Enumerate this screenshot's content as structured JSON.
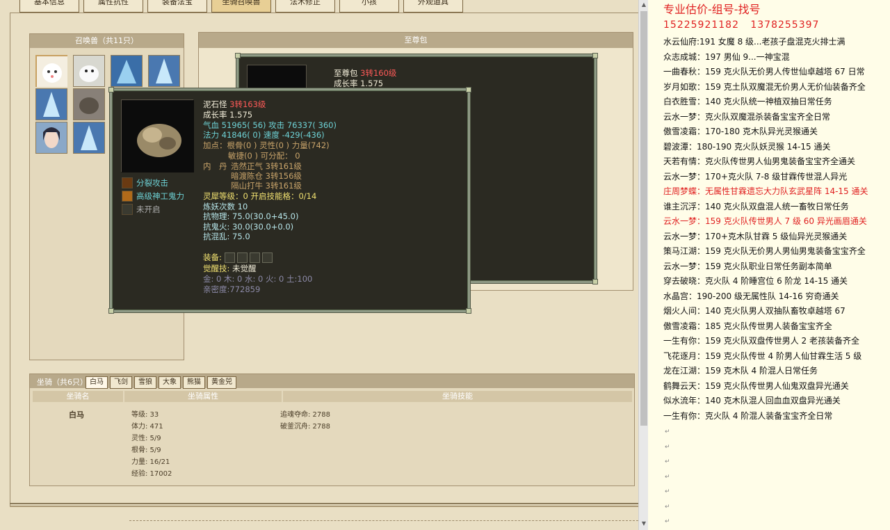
{
  "tabs": [
    "基本信息",
    "属性抗性",
    "装备法宝",
    "坐骑召唤兽",
    "法术修正",
    "小孩",
    "外观道具"
  ],
  "active_tab": 3,
  "summon_panel": {
    "title": "召唤兽（共11只）"
  },
  "my_panel": {
    "title": "至尊包"
  },
  "back_tip": {
    "name": "至尊包",
    "level": "3转160级",
    "growth": "成长率 1.575"
  },
  "tip": {
    "name": "泥石怪",
    "level": "3转163级",
    "growth": "成长率 1.575",
    "hp_label": "气血",
    "hp_val": "51965( 56)",
    "atk_label": "攻击",
    "atk_val": "76337( 360)",
    "mp_label": "法力",
    "mp_val": "41846( 0)",
    "spd_label": "速度",
    "spd_val": "-429(-436)",
    "points1": "加点：根骨(0 ) 灵性(0 ) 力量(742)",
    "points2": "敏捷(0 ) 可分配： 0",
    "inner_label": "内　丹",
    "inner1": "浩然正气 3转161级",
    "inner2": "暗渡陈仓 3转156级",
    "inner3": "隔山打牛 3转161级",
    "spirit_a": "灵犀等级：",
    "spirit_b": "0",
    "spirit_c": "开启技能格：",
    "spirit_d": "0/14",
    "refine_label": "炼妖次数",
    "refine_val": "10",
    "res1_label": "抗物理:",
    "res1_val": "75.0(30.0+45.0)",
    "res2_label": "抗鬼火:",
    "res2_val": "30.0(30.0+0.0)",
    "res3_label": "抗混乱:",
    "res3_val": "75.0",
    "equip_label": "装备:",
    "awake_label": "觉醒技:",
    "awake_val": "未觉醒",
    "elements": "金: 0 木: 0 水: 0 火: 0 土:100",
    "intimacy": "亲密度:772859",
    "skills": [
      "分裂攻击",
      "高级神工鬼力",
      "未开启"
    ]
  },
  "mount": {
    "title": "坐骑（共6只）",
    "tabs": [
      "白马",
      "飞剑",
      "雪狼",
      "大象",
      "熊猫",
      "黄金兕"
    ],
    "headers": [
      "坐骑名",
      "坐骑属性",
      "坐骑技能"
    ],
    "name": "白马",
    "attrs": [
      "等级: 33",
      "体力: 471",
      "灵性: 5/9",
      "根骨: 5/9",
      "力量: 16/21",
      "经验: 17002"
    ],
    "skills": [
      "追魂夺命: 2788",
      "破釜沉舟: 2788"
    ]
  },
  "doc": {
    "title": "专业估价-组号-找号",
    "phone1": "15225921182",
    "phone2": "1378255397",
    "lines": [
      {
        "t": "水云仙府:191 女魔 8 级...老孩子盘混克火排士满",
        "red": false
      },
      {
        "t": "众志成城：197 男仙 9...一神宝混",
        "red": false
      },
      {
        "t": "一曲春秋：159 克火队无价男人传世仙卓越塔 67 日常",
        "red": false
      },
      {
        "t": "岁月如歌：159 克土队双魔混无价男人无价仙装备齐全",
        "red": false
      },
      {
        "t": "白衣胜雪：140 克火队统一神植双抽日常任务",
        "red": false
      },
      {
        "t": "云水一梦：克火队双魔混杀装备宝宝齐全日常",
        "red": false
      },
      {
        "t": "傲雪凌霜：170-180 克木队异光灵猴通关",
        "red": false
      },
      {
        "t": "碧波潭：180-190 克火队妖灵猴 14-15 通关",
        "red": false
      },
      {
        "t": "天若有情：克火队传世男人仙男鬼装备宝宝齐全通关",
        "red": false
      },
      {
        "t": "云水一梦：170+克火队 7-8 级甘霖传世混人异光",
        "red": false
      },
      {
        "t": "庄周梦蝶：无属性甘霖遗忘大力队玄武星阵 14-15 通关",
        "red": true
      },
      {
        "t": "谁主沉浮：140 克火队双盘混人统一畜牧日常任务",
        "red": false
      },
      {
        "t": "云水一梦：159 克火队传世男人 7 级 60 异光画眉通关",
        "red": true
      },
      {
        "t": "云水一梦：170+克木队甘霖 5 级仙异光灵猴通关",
        "red": false
      },
      {
        "t": "策马江湖：159 克火队无价男人男仙男鬼装备宝宝齐全",
        "red": false
      },
      {
        "t": "云水一梦：159 克火队职业日常任务副本简单",
        "red": false
      },
      {
        "t": "穿去破晓：克火队 4 阶睡宫位 6 阶龙 14-15 通关",
        "red": false
      },
      {
        "t": "水晶宫：190-200 级无属性队 14-16 穷奇通关",
        "red": false
      },
      {
        "t": "烟火人间：140 克火队男人双抽队畜牧卓越塔 67",
        "red": false
      },
      {
        "t": "傲雪凌霜：185 克火队传世男人装备宝宝齐全",
        "red": false
      },
      {
        "t": "一生有你：159 克火队双盘传世男人 2 老孩装备齐全",
        "red": false
      },
      {
        "t": "飞花逐月：159 克火队传世 4 阶男人仙甘霖生活 5 级",
        "red": false
      },
      {
        "t": "龙在江湖：159 克木队 4 阶混人日常任务",
        "red": false
      },
      {
        "t": "鹤舞云天：159 克火队传世男人仙鬼双盘异光通关",
        "red": false
      },
      {
        "t": "似水流年：140 克木队混人回血血双盘异光通关",
        "red": false
      },
      {
        "t": "一生有你：克火队 4 阶混人装备宝宝齐全日常",
        "red": false
      }
    ]
  },
  "colors": {
    "panel": "#e9dfc4",
    "tooltip": "#2b2a22",
    "red": "#e02020",
    "cyan": "#6ed2d6"
  }
}
